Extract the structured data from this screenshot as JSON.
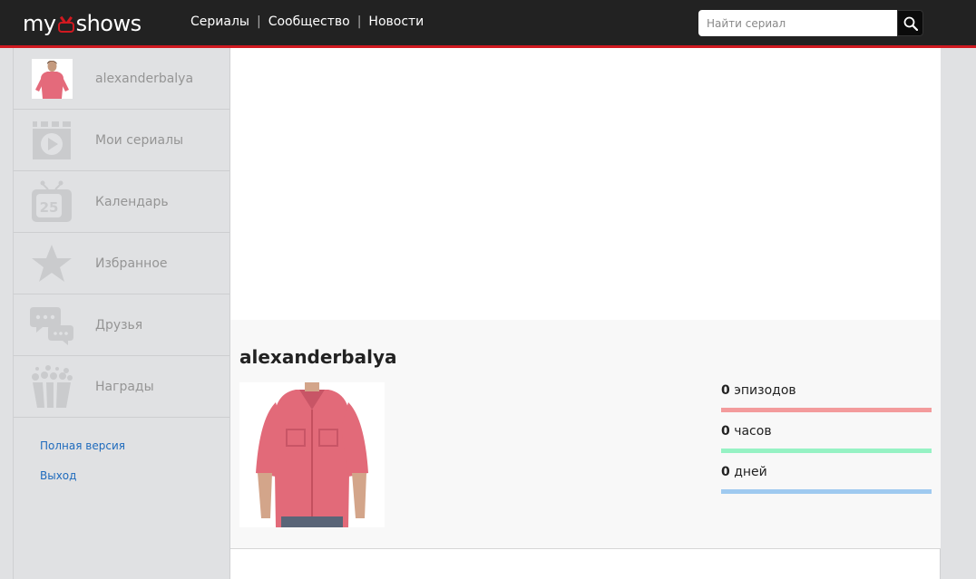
{
  "header": {
    "logo": {
      "left": "my",
      "right": "shows",
      "icon": "tv-icon"
    },
    "nav": [
      "Сериалы",
      "Сообщество",
      "Новости"
    ],
    "nav_separator": "|",
    "search_placeholder": "Найти сериал",
    "search_icon": "search-icon",
    "accent_color": "#d01920"
  },
  "sidebar": {
    "user": {
      "name": "alexanderbalya"
    },
    "items": [
      {
        "label": "Мои сериалы",
        "icon": "play-film-icon"
      },
      {
        "label": "Календарь",
        "icon": "calendar-icon",
        "badge": "25"
      },
      {
        "label": "Избранное",
        "icon": "star-icon"
      },
      {
        "label": "Друзья",
        "icon": "chat-bubbles-icon"
      },
      {
        "label": "Награды",
        "icon": "popcorn-icon"
      }
    ],
    "links": [
      "Полная версия",
      "Выход"
    ]
  },
  "profile": {
    "name": "alexanderbalya",
    "stats": [
      {
        "value": "0",
        "label": "эпизодов",
        "color": "#f39b9c"
      },
      {
        "value": "0",
        "label": "часов",
        "color": "#96f2c4"
      },
      {
        "value": "0",
        "label": "дней",
        "color": "#9fcaf0"
      }
    ]
  }
}
